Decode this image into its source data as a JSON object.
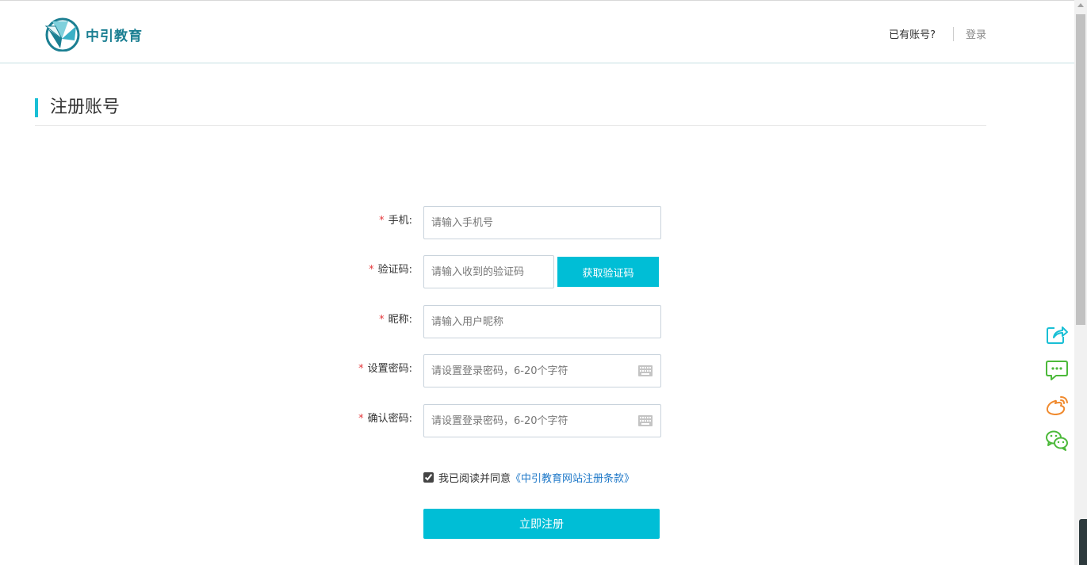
{
  "header": {
    "logo_text": "中引教育",
    "have_account": "已有账号?",
    "login_link": "登录"
  },
  "title": "注册账号",
  "form": {
    "phone": {
      "label": "手机:",
      "placeholder": "请输入手机号",
      "value": ""
    },
    "code": {
      "label": "验证码:",
      "placeholder": "请输入收到的验证码",
      "value": "",
      "button": "获取验证码"
    },
    "nickname": {
      "label": "昵称:",
      "placeholder": "请输入用户昵称",
      "value": ""
    },
    "password": {
      "label": "设置密码:",
      "placeholder": "请设置登录密码，6-20个字符",
      "value": ""
    },
    "confirm": {
      "label": "确认密码:",
      "placeholder": "请设置登录密码，6-20个字符",
      "value": ""
    },
    "required_mark": "*",
    "agree": {
      "checked": true,
      "text": "我已阅读并同意",
      "link": "《中引教育网站注册条款》"
    },
    "submit": "立即注册"
  },
  "share": [
    "share-icon",
    "message-icon",
    "weibo-icon",
    "wechat-icon"
  ],
  "colors": {
    "accent": "#00bed6",
    "brand": "#1b7f92",
    "required": "#e4393c",
    "link": "#1e78c8",
    "weibo": "#f08a2e",
    "green": "#4cb93a"
  }
}
